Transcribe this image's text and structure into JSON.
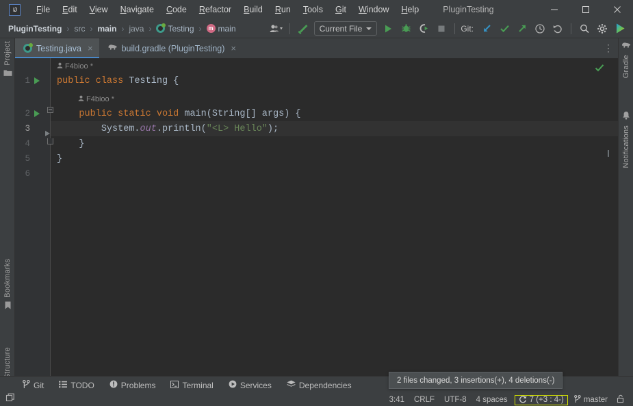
{
  "window": {
    "title": "PluginTesting",
    "logo_text": "IJ",
    "controls": [
      {
        "name": "minimize-button",
        "glyph": "minimize"
      },
      {
        "name": "maximize-button",
        "glyph": "maximize"
      },
      {
        "name": "close-button",
        "glyph": "close"
      }
    ]
  },
  "menubar": {
    "items": [
      {
        "label": "File",
        "mnemonic": "F"
      },
      {
        "label": "Edit",
        "mnemonic": "E"
      },
      {
        "label": "View",
        "mnemonic": "V"
      },
      {
        "label": "Navigate",
        "mnemonic": "N"
      },
      {
        "label": "Code",
        "mnemonic": "C"
      },
      {
        "label": "Refactor",
        "mnemonic": "R"
      },
      {
        "label": "Build",
        "mnemonic": "B"
      },
      {
        "label": "Run",
        "mnemonic": "R"
      },
      {
        "label": "Tools",
        "mnemonic": "T"
      },
      {
        "label": "Git",
        "mnemonic": "G"
      },
      {
        "label": "Window",
        "mnemonic": "W"
      },
      {
        "label": "Help",
        "mnemonic": "H"
      }
    ]
  },
  "breadcrumbs": {
    "items": [
      {
        "label": "PluginTesting",
        "icon": "none",
        "style": "bold"
      },
      {
        "label": "src",
        "icon": "none",
        "style": "dim"
      },
      {
        "label": "main",
        "icon": "none",
        "style": "bold"
      },
      {
        "label": "java",
        "icon": "none",
        "style": "dim"
      },
      {
        "label": "Testing",
        "icon": "class-icon",
        "style": "normal"
      },
      {
        "label": "main",
        "icon": "method-icon",
        "style": "normal"
      }
    ],
    "separator": "›"
  },
  "toolbar": {
    "avatar_icon": "user-group-icon",
    "build_icon": "hammer-icon",
    "run_config": {
      "label": "Current File",
      "chevron": "chevron-down-icon"
    },
    "run_icon": "run-icon",
    "debug_icon": "debug-icon",
    "coverage_icon": "run-with-coverage-icon",
    "stop_icon": "stop-icon",
    "git_label": "Git:",
    "git_update_icon": "git-update-icon",
    "git_commit_icon": "git-commit-icon",
    "git_push_icon": "git-push-icon",
    "git_history_icon": "git-history-icon",
    "git_rollback_icon": "git-rollback-icon",
    "search_icon": "search-icon",
    "settings_icon": "gear-icon",
    "ai_icon": "ai-assistant-icon",
    "colors": {
      "run_green": "#499c54",
      "git_blue": "#3592c4",
      "accent_yellow": "#d2e000"
    }
  },
  "left_stripe": {
    "items": [
      {
        "label": "Project",
        "icon": "folder-icon"
      },
      {
        "label": "Bookmarks",
        "icon": "bookmark-icon"
      },
      {
        "label": "Structure",
        "icon": "structure-icon"
      }
    ]
  },
  "right_stripe": {
    "items": [
      {
        "label": "Gradle",
        "icon": "gradle-elephant-icon"
      },
      {
        "label": "Notifications",
        "icon": "bell-icon"
      }
    ]
  },
  "tabs": {
    "items": [
      {
        "label": "Testing.java",
        "icon": "java-class-icon",
        "active": true,
        "close": "×"
      },
      {
        "label": "build.gradle (PluginTesting)",
        "icon": "gradle-elephant-icon",
        "active": false,
        "close": "×"
      }
    ],
    "overflow_menu": "⋮"
  },
  "editor": {
    "inspection_status": "check-icon",
    "line_numbers": [
      "1",
      "2",
      "3",
      "4",
      "5",
      "6"
    ],
    "current_line": 3,
    "inlay_hints": [
      {
        "text": "F4bioo *",
        "icon": "author-icon"
      },
      {
        "text": "F4bioo *",
        "icon": "author-icon"
      }
    ],
    "lines": [
      {
        "num": "1",
        "tokens": [
          {
            "t": "public",
            "c": "kw"
          },
          {
            "t": " ",
            "c": "punc"
          },
          {
            "t": "class",
            "c": "kw"
          },
          {
            "t": " ",
            "c": "punc"
          },
          {
            "t": "Testing",
            "c": "cls"
          },
          {
            "t": " {",
            "c": "punc"
          }
        ]
      },
      {
        "num": "2",
        "tokens": [
          {
            "t": "    ",
            "c": "punc"
          },
          {
            "t": "public",
            "c": "kw"
          },
          {
            "t": " ",
            "c": "punc"
          },
          {
            "t": "static",
            "c": "kw"
          },
          {
            "t": " ",
            "c": "punc"
          },
          {
            "t": "void",
            "c": "kw"
          },
          {
            "t": " ",
            "c": "punc"
          },
          {
            "t": "main",
            "c": "cls"
          },
          {
            "t": "(",
            "c": "punc"
          },
          {
            "t": "String[] args",
            "c": "cls"
          },
          {
            "t": ") {",
            "c": "punc"
          }
        ]
      },
      {
        "num": "3",
        "tokens": [
          {
            "t": "        ",
            "c": "punc"
          },
          {
            "t": "System",
            "c": "cls"
          },
          {
            "t": ".",
            "c": "punc"
          },
          {
            "t": "out",
            "c": "fld"
          },
          {
            "t": ".",
            "c": "punc"
          },
          {
            "t": "println",
            "c": "mth"
          },
          {
            "t": "(",
            "c": "punc"
          },
          {
            "t": "\"<L> Hello\"",
            "c": "str"
          },
          {
            "t": ");",
            "c": "punc"
          }
        ]
      },
      {
        "num": "4",
        "tokens": [
          {
            "t": "    }",
            "c": "punc"
          }
        ]
      },
      {
        "num": "5",
        "tokens": [
          {
            "t": "}",
            "c": "punc"
          }
        ]
      },
      {
        "num": "6",
        "tokens": []
      }
    ],
    "syntax_colors": {
      "keyword": "#cc7832",
      "identifier": "#a9b7c6",
      "field": "#9876aa",
      "string": "#6a8759",
      "background": "#2b2b2b",
      "gutter": "#313335",
      "current_line": "#323232"
    }
  },
  "bottom_bar": {
    "items": [
      {
        "label": "Git",
        "icon": "git-branch-icon"
      },
      {
        "label": "TODO",
        "icon": "list-icon"
      },
      {
        "label": "Problems",
        "icon": "warning-icon"
      },
      {
        "label": "Terminal",
        "icon": "terminal-icon"
      },
      {
        "label": "Services",
        "icon": "services-icon"
      },
      {
        "label": "Dependencies",
        "icon": "layers-icon"
      }
    ]
  },
  "status_bar": {
    "layout_icon": "layout-icon",
    "caret_position": "3:41",
    "line_separator": "CRLF",
    "encoding": "UTF-8",
    "indent": "4 spaces",
    "vcs_badge": {
      "icon": "refresh-icon",
      "text": "7 (+3 : 4-)"
    },
    "branch": {
      "icon": "git-branch-icon",
      "label": "master"
    },
    "lock_icon": "read-write-icon"
  },
  "tooltip": {
    "text": "2 files changed, 3 insertions(+), 4 deletions(-)"
  }
}
